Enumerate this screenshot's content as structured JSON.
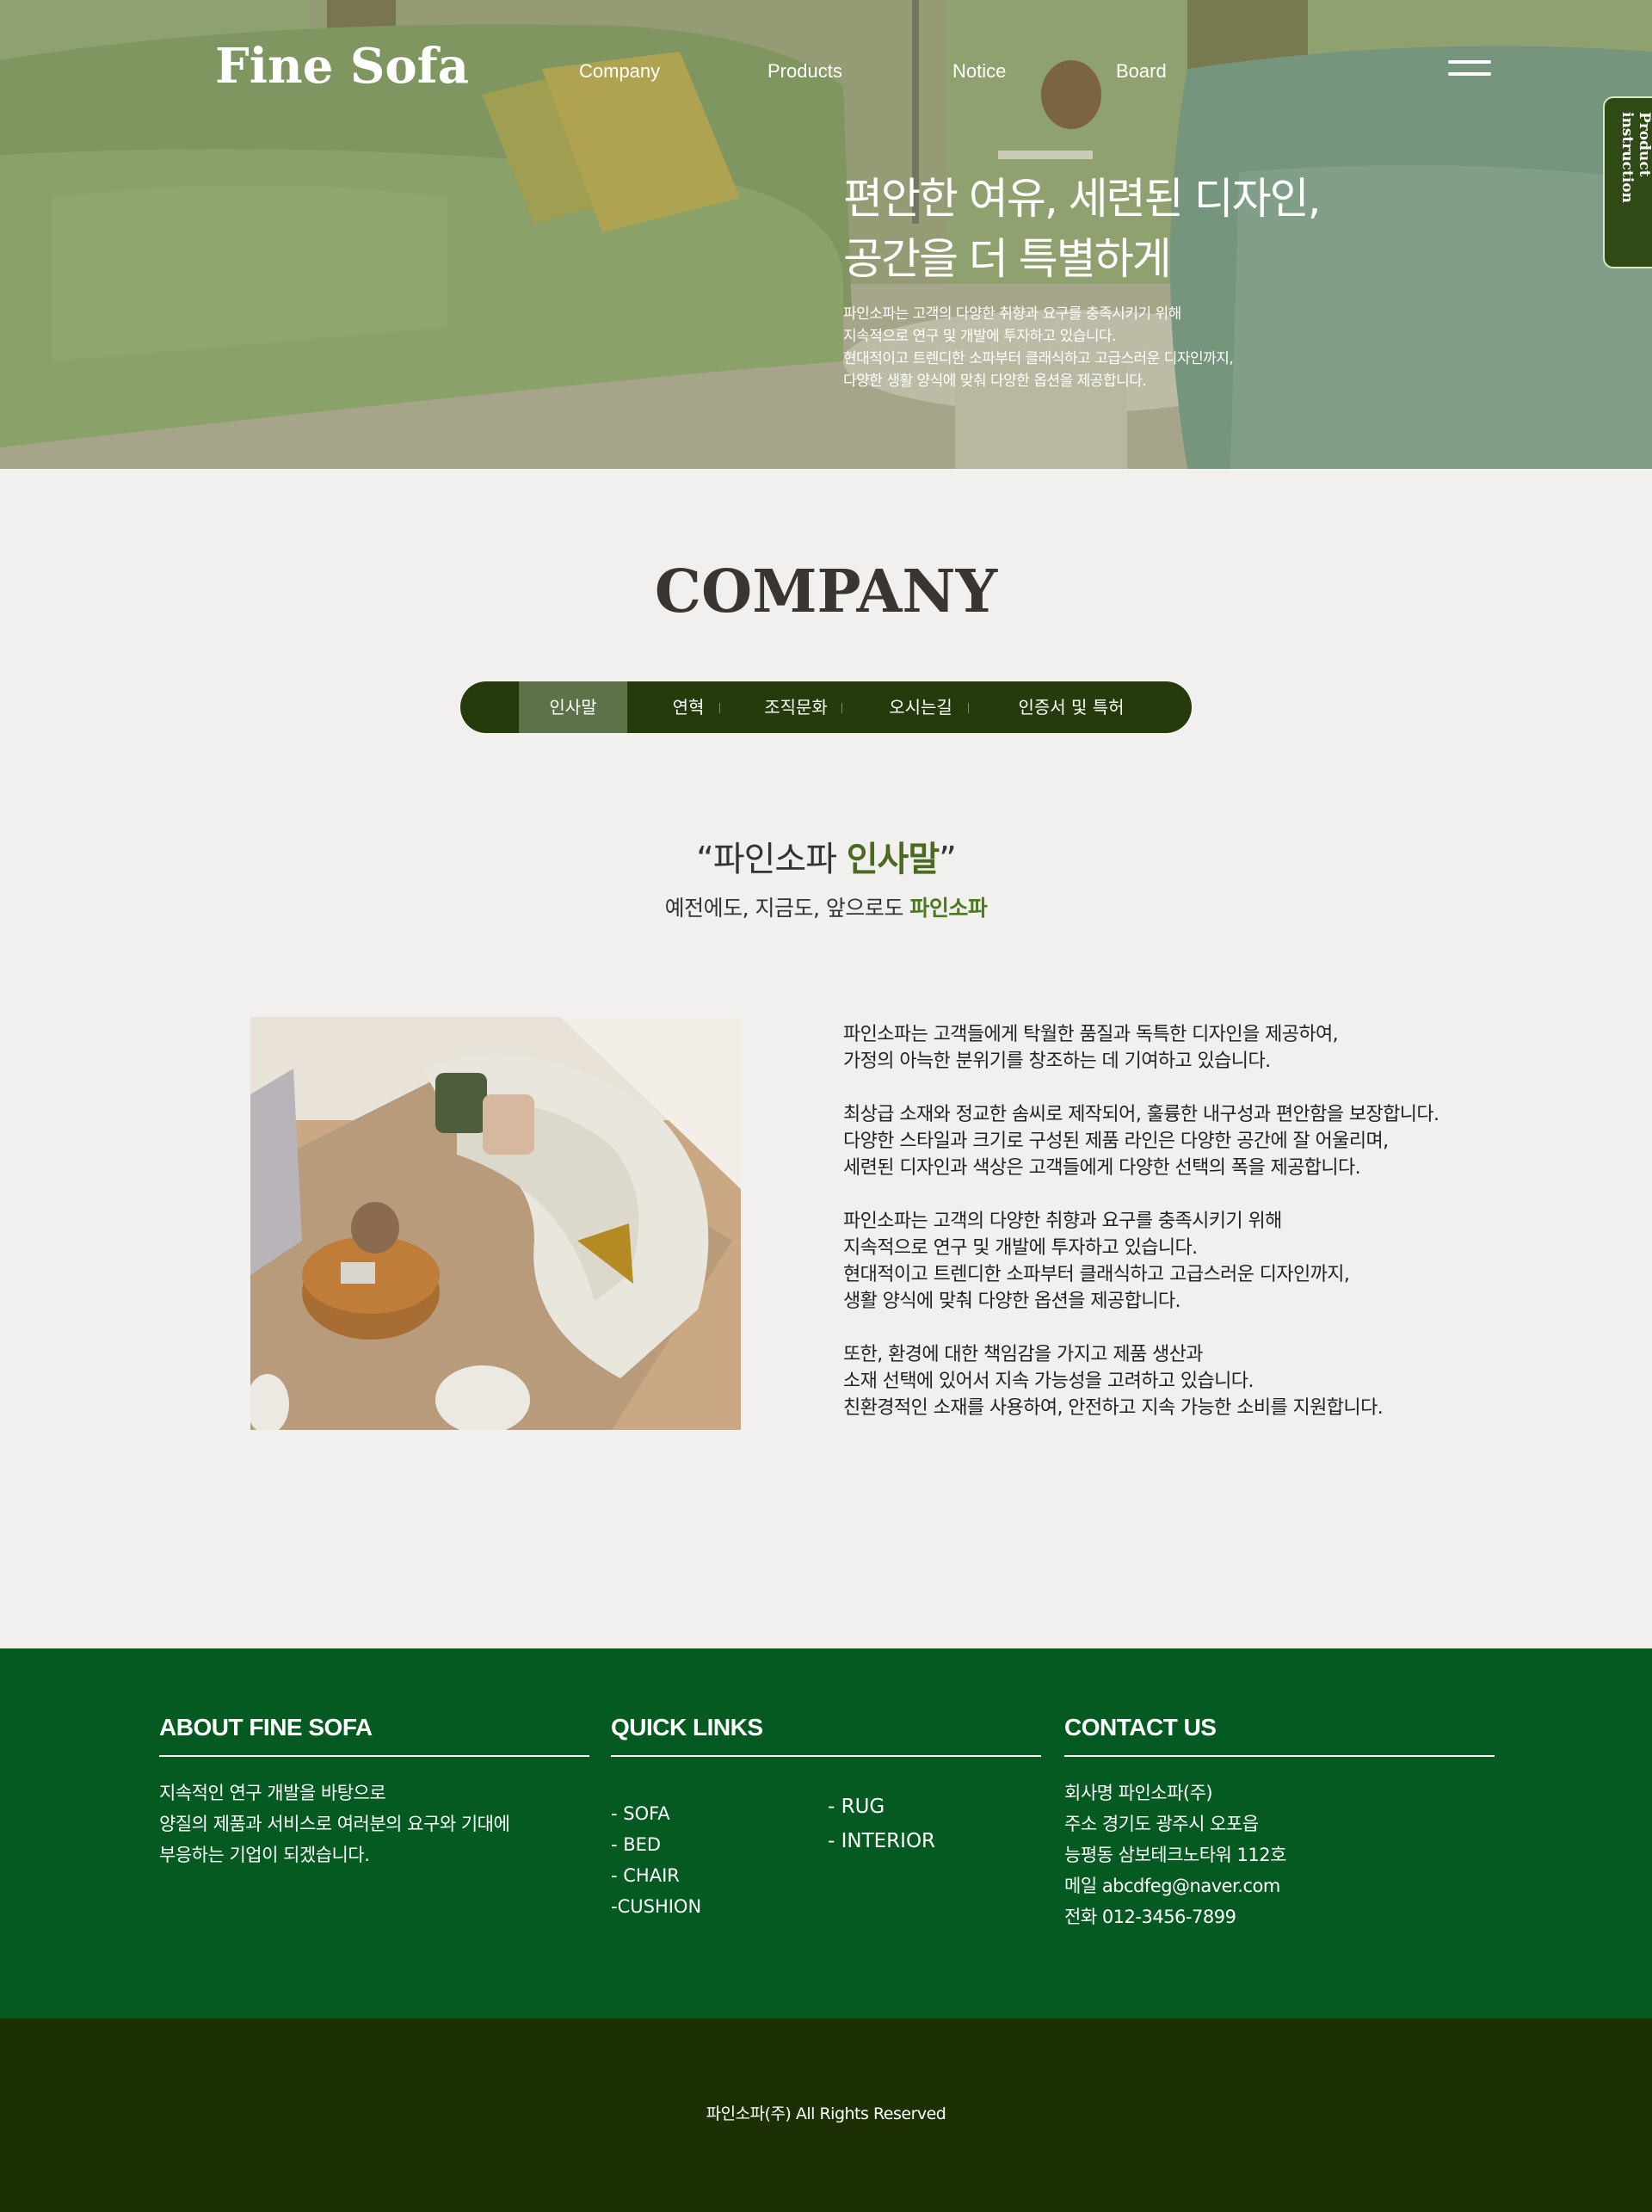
{
  "brand": {
    "logo": "Fine Sofa"
  },
  "nav": {
    "items": [
      "Company",
      "Products",
      "Notice",
      "Board"
    ]
  },
  "side_tab": {
    "label": "Product instruction"
  },
  "hero": {
    "title_line1": "편안한 여유, 세련된 디자인,",
    "title_line2": "공간을 더 특별하게",
    "desc": [
      "파인소파는 고객의 다양한 취향과 요구를 충족시키기 위해",
      "지속적으로 연구 및 개발에 투자하고 있습니다.",
      "현대적이고 트렌디한 소파부터 클래식하고 고급스러운 디자인까지,",
      "다양한 생활 양식에 맞춰 다양한 옵션을 제공합니다."
    ]
  },
  "company": {
    "title": "COMPANY",
    "tabs": [
      "인사말",
      "연혁",
      "조직문화",
      "오시는길",
      "인증서 및 특허"
    ],
    "active_tab": "인사말",
    "quote_open": "“파인소파 ",
    "quote_accent": "인사말",
    "quote_close": "”",
    "sub_prefix": "예전에도, 지금도, 앞으로도 ",
    "sub_accent": "파인소파",
    "paragraphs": [
      "파인소파는 고객들에게 탁월한 품질과 독특한 디자인을 제공하여,\n가정의 아늑한 분위기를 창조하는 데 기여하고 있습니다.",
      "최상급 소재와 정교한 솜씨로 제작되어, 훌륭한 내구성과 편안함을 보장합니다.\n다양한 스타일과 크기로 구성된 제품 라인은 다양한 공간에 잘 어울리며,\n세련된 디자인과 색상은 고객들에게 다양한 선택의 폭을 제공합니다.",
      "파인소파는 고객의 다양한 취향과 요구를 충족시키기 위해\n지속적으로 연구 및 개발에 투자하고 있습니다.\n현대적이고 트렌디한 소파부터 클래식하고 고급스러운 디자인까지,\n생활 양식에 맞춰 다양한 옵션을 제공합니다.",
      "또한, 환경에 대한 책임감을 가지고 제품 생산과\n소재 선택에 있어서 지속 가능성을 고려하고 있습니다.\n친환경적인 소재를 사용하여, 안전하고 지속 가능한 소비를 지원합니다."
    ]
  },
  "footer": {
    "about": {
      "title": "ABOUT FINE SOFA",
      "lines": [
        "지속적인 연구 개발을 바탕으로",
        "양질의 제품과 서비스로 여러분의 요구와 기대에",
        "부응하는 기업이 되겠습니다."
      ]
    },
    "links": {
      "title": "QUICK LINKS",
      "col_a": [
        "- SOFA",
        "- BED",
        "- CHAIR",
        "-CUSHION"
      ],
      "col_b": [
        "- RUG",
        "- INTERIOR"
      ]
    },
    "contact": {
      "title": "CONTACT US",
      "lines": [
        "회사명 파인소파(주)",
        "주소 경기도 광주시 오포읍",
        "능평동 삼보테크노타워 112호",
        "메일 abcdfeg@naver.com",
        "전화 012-3456-7899"
      ]
    },
    "copyright": "파인소파(주) All Rights Reserved"
  },
  "colors": {
    "tab_bar": "#263b0c",
    "tab_active": "#5e7249",
    "accent_green": "#4a6a20",
    "footer_green": "#045a20",
    "bottom_bar": "#1d3005",
    "page_bg": "#f1f0ee"
  }
}
